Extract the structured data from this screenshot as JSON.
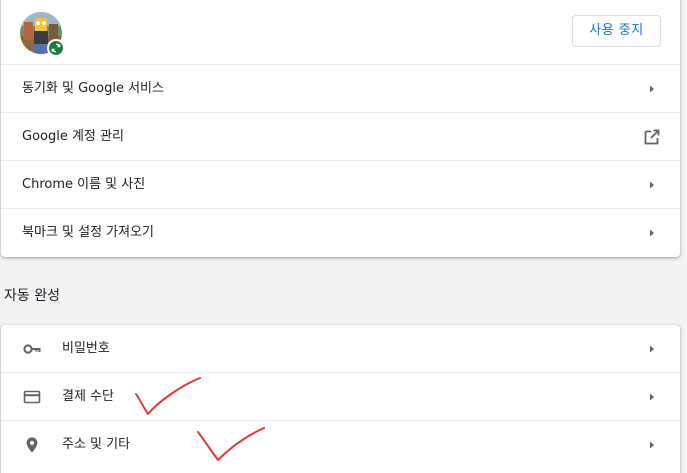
{
  "people": {
    "stop_sync_label": "사용 중지",
    "rows": [
      {
        "label": "동기화 및 Google 서비스"
      },
      {
        "label": "Google 계정 관리"
      },
      {
        "label": "Chrome 이름 및 사진"
      },
      {
        "label": "북마크 및 설정 가져오기"
      }
    ]
  },
  "autofill": {
    "title": "자동 완성",
    "rows": [
      {
        "label": "비밀번호",
        "icon": "key-icon"
      },
      {
        "label": "결제 수단",
        "icon": "credit-card-icon"
      },
      {
        "label": "주소 및 기타",
        "icon": "location-pin-icon"
      }
    ]
  },
  "colors": {
    "accent": "#1a73e8",
    "sync_badge": "#188038",
    "annotation": "#e53935"
  }
}
